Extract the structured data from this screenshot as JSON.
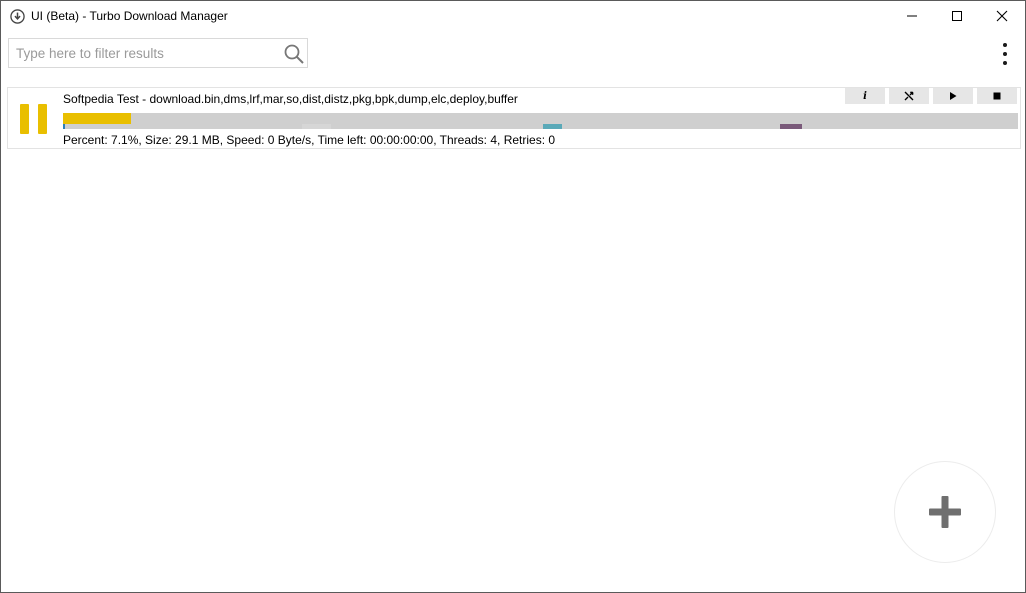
{
  "window": {
    "title": "UI (Beta) - Turbo Download Manager"
  },
  "filter": {
    "placeholder": "Type here to filter results",
    "value": ""
  },
  "downloads": [
    {
      "name": "Softpedia Test - download.bin,dms,lrf,mar,so,dist,distz,pkg,bpk,dump,elc,deploy,buffer",
      "status": "Percent: 7.1%, Size: 29.1 MB, Speed: 0 Byte/s, Time left: 00:00:00:00, Threads: 4, Retries: 0",
      "percent": 7.1,
      "thread_segments": [
        {
          "start": 0.0,
          "end": 0.0015,
          "color": "#2c7fb8"
        },
        {
          "start": 0.503,
          "end": 0.523,
          "color": "#5aa9b8"
        },
        {
          "start": 0.751,
          "end": 0.774,
          "color": "#7a5a7a"
        }
      ],
      "actions": [
        "info-icon",
        "tools-icon",
        "play-icon",
        "stop-icon"
      ]
    }
  ],
  "colors": {
    "accent": "#e9bf00",
    "progress_track": "#cfcfcf",
    "action_bg": "#e6e6e6"
  }
}
